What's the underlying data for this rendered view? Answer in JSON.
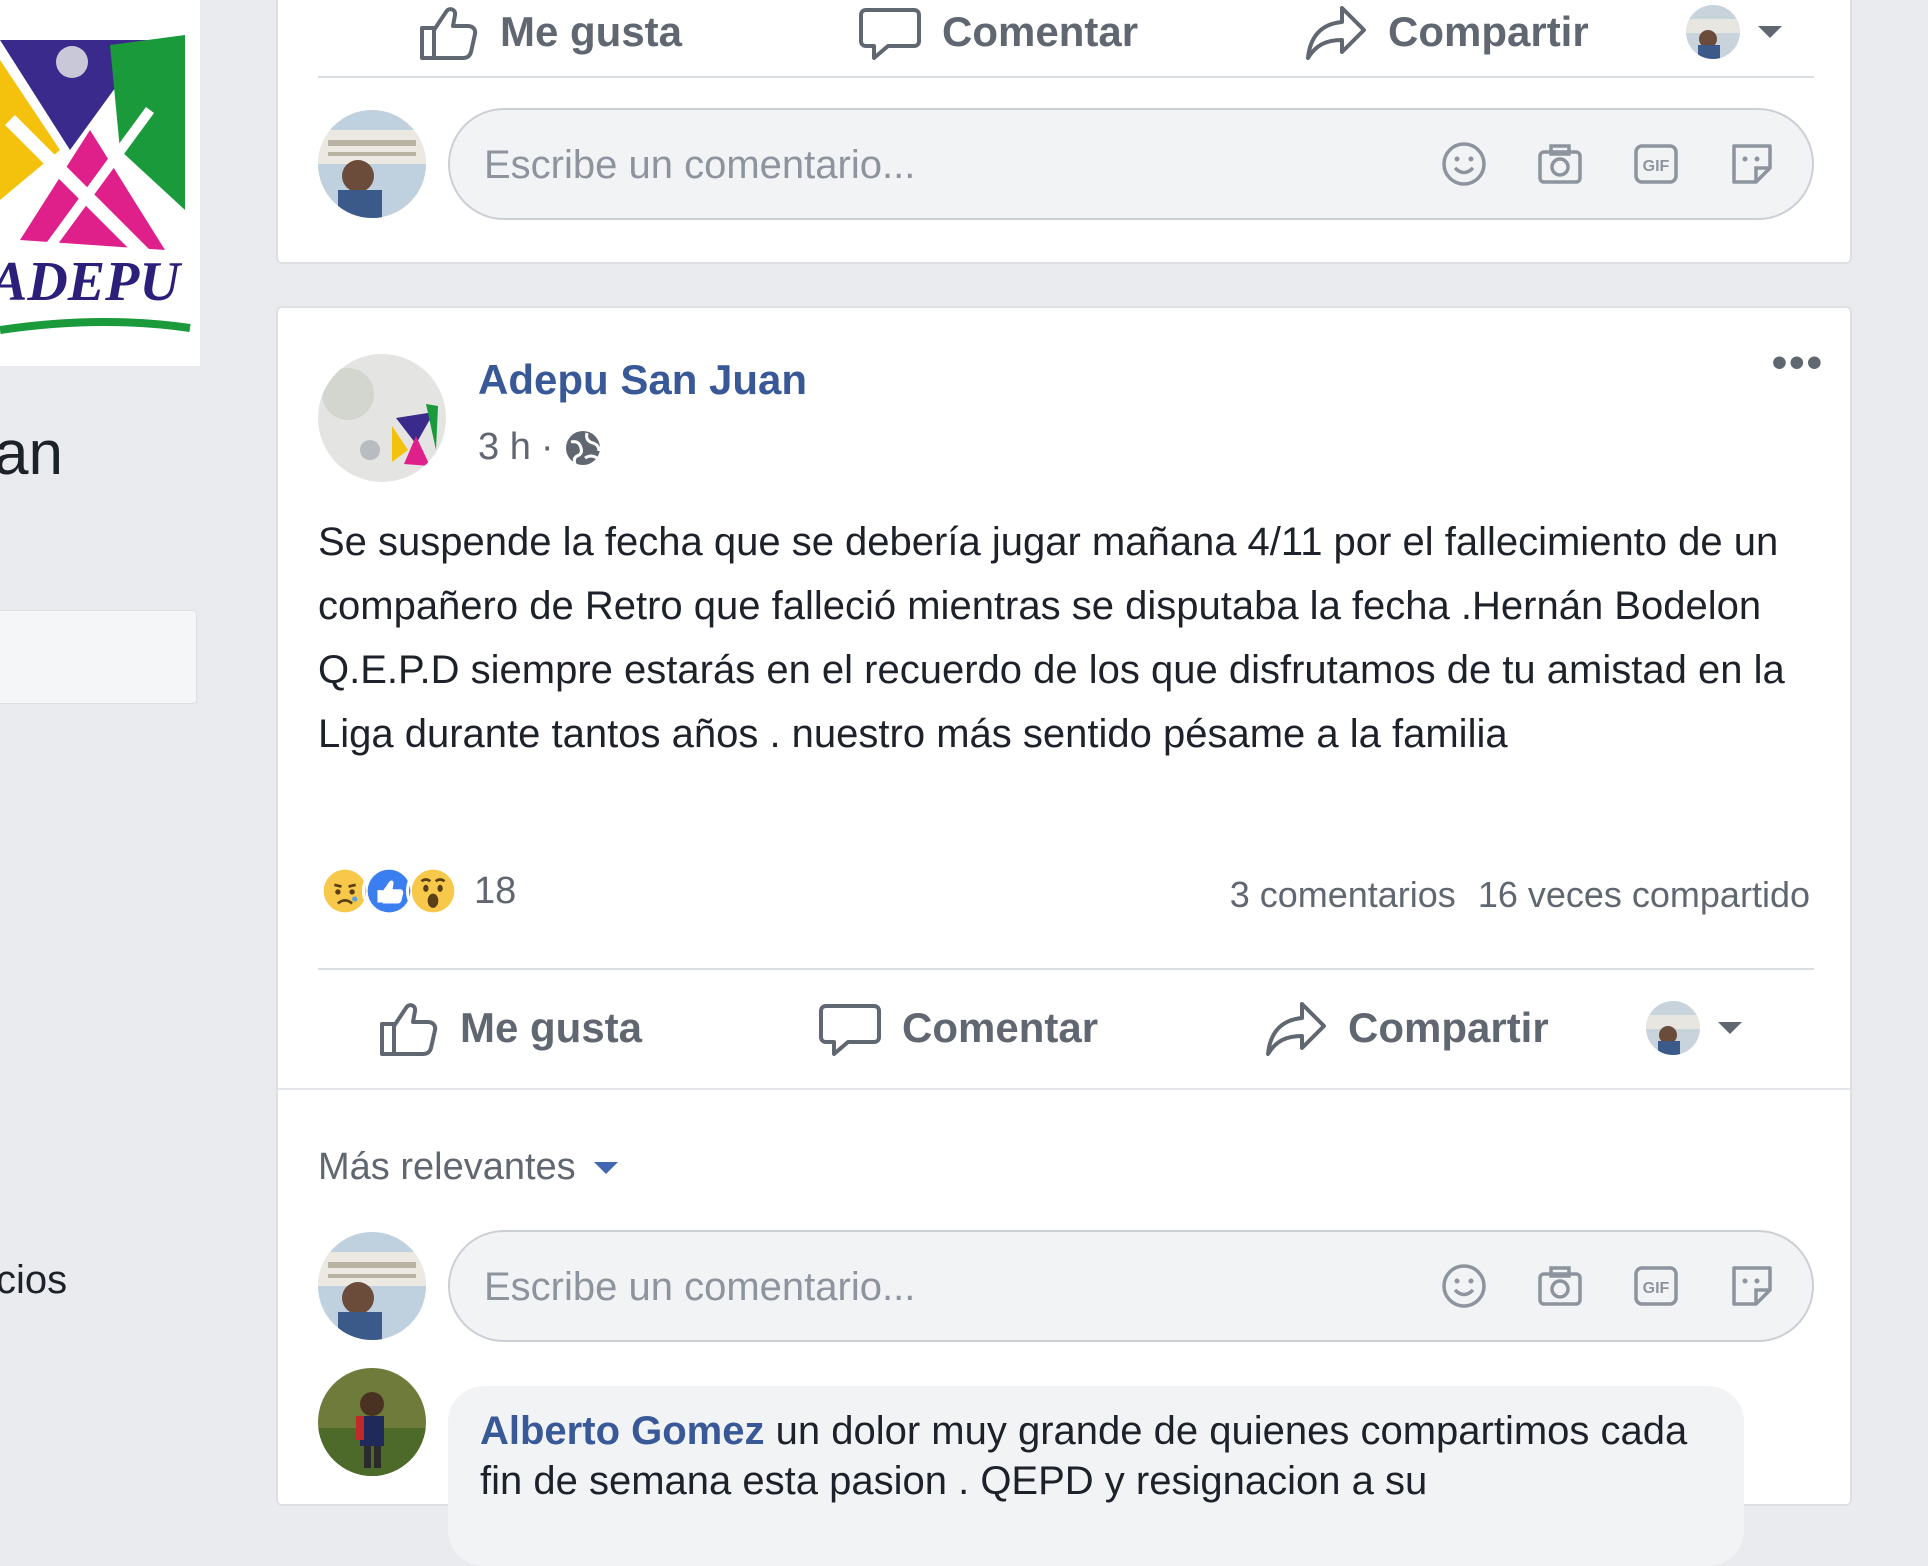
{
  "sidebar": {
    "page_name_fragment": "an",
    "menu_item_fragment": "cios",
    "logo_text": "ADEPU"
  },
  "top_card": {
    "actions": {
      "like": "Me gusta",
      "comment": "Comentar",
      "share": "Compartir"
    },
    "comment_placeholder": "Escribe un comentario..."
  },
  "post": {
    "author": "Adepu San Juan",
    "time": "3 h",
    "separator": "·",
    "text": "Se suspende la fecha que se debería jugar mañana 4/11 por el fallecimiento de un compañero de Retro que falleció mientras se disputaba la fecha .Hernán Bodelon Q.E.P.D siempre estarás en el recuerdo de los que disfrutamos de tu amistad en la Liga durante tantos años . nuestro más sentido pésame a la familia",
    "reactions": {
      "icons": [
        "sad-reaction",
        "like-reaction",
        "wow-reaction"
      ],
      "count": "18"
    },
    "comments_count": "3 comentarios",
    "shares_count": "16 veces compartido",
    "actions": {
      "like": "Me gusta",
      "comment": "Comentar",
      "share": "Compartir"
    },
    "sort_label": "Más relevantes",
    "comment_placeholder": "Escribe un comentario...",
    "comments": [
      {
        "author": "Alberto Gomez",
        "text": "un dolor muy grande de quienes compartimos cada fin de semana esta pasion . QEPD y resignacion a su"
      }
    ]
  },
  "colors": {
    "background": "#e9ebee",
    "link_blue": "#385898",
    "secondary_text": "#606770",
    "card_border": "#dddfe2"
  }
}
